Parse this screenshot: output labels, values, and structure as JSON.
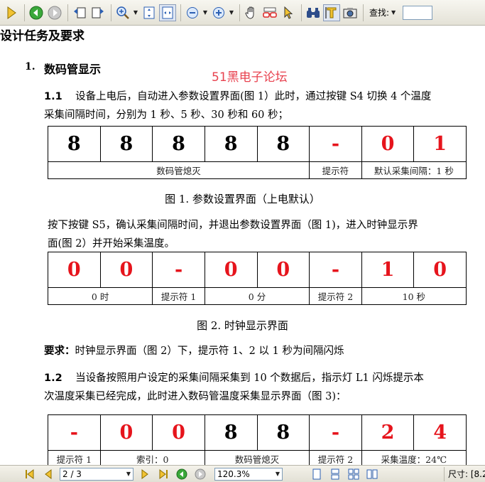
{
  "toolbar": {
    "icons": [
      "play-icon",
      "back-icon",
      "forward-icon",
      "page-back-icon",
      "page-forward-icon",
      "zoom-icon",
      "fit-page-icon",
      "fit-width-icon",
      "zoom-out-icon",
      "zoom-in-icon",
      "hand-icon",
      "glasses-icon",
      "arrow-cursor-icon",
      "binoculars-icon",
      "text-select-icon",
      "camera-icon"
    ],
    "find_label": "查找:",
    "find_value": ""
  },
  "doc": {
    "section_title": "设计任务及要求",
    "heading_num": "1.",
    "heading_text": "数码管显示",
    "watermark": "51黑电子论坛",
    "p11_num": "1.1",
    "p11_line1": "设备上电后，自动进入参数设置界面(图 1）此时，通过按键 S4 切换 4 个温度",
    "p11_line2": "采集间隔时间，分别为 1 秒、5 秒、30 秒和 60 秒；",
    "table1": {
      "digits": [
        {
          "v": "8",
          "red": false
        },
        {
          "v": "8",
          "red": false
        },
        {
          "v": "8",
          "red": false
        },
        {
          "v": "8",
          "red": false
        },
        {
          "v": "8",
          "red": false
        },
        {
          "v": "-",
          "red": true
        },
        {
          "v": "0",
          "red": true
        },
        {
          "v": "1",
          "red": true
        }
      ],
      "labels": [
        {
          "text": "数码管熄灭",
          "span": 5
        },
        {
          "text": "提示符",
          "span": 1
        },
        {
          "text": "默认采集间隔：1 秒",
          "span": 2
        }
      ]
    },
    "caption1": "图 1. 参数设置界面（上电默认）",
    "p2_line1": "按下按键 S5，确认采集间隔时间，并退出参数设置界面（图 1)，进入时钟显示界",
    "p2_line2": "面(图 2）并开始采集温度。",
    "table2": {
      "digits": [
        {
          "v": "0",
          "red": true
        },
        {
          "v": "0",
          "red": true
        },
        {
          "v": "-",
          "red": true
        },
        {
          "v": "0",
          "red": true
        },
        {
          "v": "0",
          "red": true
        },
        {
          "v": "-",
          "red": true
        },
        {
          "v": "1",
          "red": true
        },
        {
          "v": "0",
          "red": true
        }
      ],
      "labels": [
        {
          "text": "0 时",
          "span": 2
        },
        {
          "text": "提示符 1",
          "span": 1
        },
        {
          "text": "0 分",
          "span": 2
        },
        {
          "text": "提示符 2",
          "span": 1
        },
        {
          "text": "10 秒",
          "span": 2
        }
      ]
    },
    "caption2": "图 2. 时钟显示界面",
    "req_bold": "要求：",
    "req_text": "时钟显示界面（图 2）下，提示符 1、2 以 1 秒为间隔闪烁",
    "p12_num": "1.2",
    "p12_line1": "当设备按照用户设定的采集间隔采集到 10 个数据后，指示灯 L1 闪烁提示本",
    "p12_line2": "次温度采集已经完成，此时进入数码管温度采集显示界面（图 3)：",
    "table3": {
      "digits": [
        {
          "v": "-",
          "red": true
        },
        {
          "v": "0",
          "red": true
        },
        {
          "v": "0",
          "red": true
        },
        {
          "v": "8",
          "red": false
        },
        {
          "v": "8",
          "red": false
        },
        {
          "v": "-",
          "red": true
        },
        {
          "v": "2",
          "red": true
        },
        {
          "v": "4",
          "red": true
        }
      ],
      "labels": [
        {
          "text": "提示符 1",
          "span": 1
        },
        {
          "text": "索引：0",
          "span": 2
        },
        {
          "text": "数码管熄灭",
          "span": 2
        },
        {
          "text": "提示符 2",
          "span": 1
        },
        {
          "text": "采集温度：24℃",
          "span": 2
        }
      ]
    }
  },
  "statusbar": {
    "page": "2 / 3",
    "zoom": "120.3%",
    "size_label": "尺寸: [8.2"
  },
  "colors": {
    "segment_red": "#e6141c",
    "watermark_red": "#e8424f",
    "toolbar_bg": "#e4e2d7"
  }
}
